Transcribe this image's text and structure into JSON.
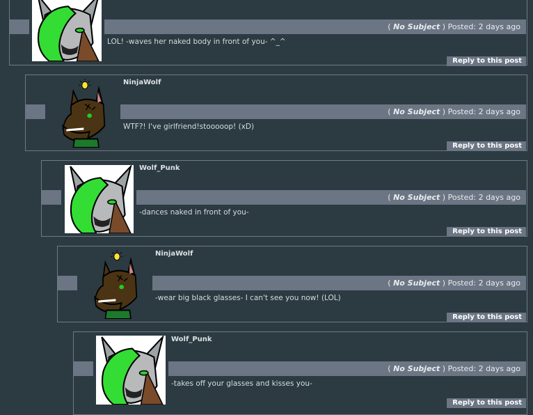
{
  "posts": [
    {
      "username": "",
      "subject": "No Subject",
      "posted": "Posted: 2 days ago",
      "message": "LOL! -waves her naked body in front of you- ^_^",
      "reply": "Reply to this post",
      "avatar": "wolf-punk"
    },
    {
      "username": "NinjaWolf",
      "subject": "No Subject",
      "posted": "Posted: 2 days ago",
      "message": "WTF?! I've girlfriend!stooooop! (xD)",
      "reply": "Reply to this post",
      "avatar": "ninjawolf"
    },
    {
      "username": "Wolf_Punk",
      "subject": "No Subject",
      "posted": "Posted: 2 days ago",
      "message": "-dances naked in front of you-",
      "reply": "Reply to this post",
      "avatar": "wolf-punk"
    },
    {
      "username": "NinjaWolf",
      "subject": "No Subject",
      "posted": "Posted: 2 days ago",
      "message": "-wear big black glasses- I can't see you now! (LOL)",
      "reply": "Reply to this post",
      "avatar": "ninjawolf"
    },
    {
      "username": "Wolf_Punk",
      "subject": "No Subject",
      "posted": "Posted: 2 days ago",
      "message": "-takes off your glasses and kisses you-",
      "reply": "Reply to this post",
      "avatar": "wolf-punk"
    }
  ]
}
